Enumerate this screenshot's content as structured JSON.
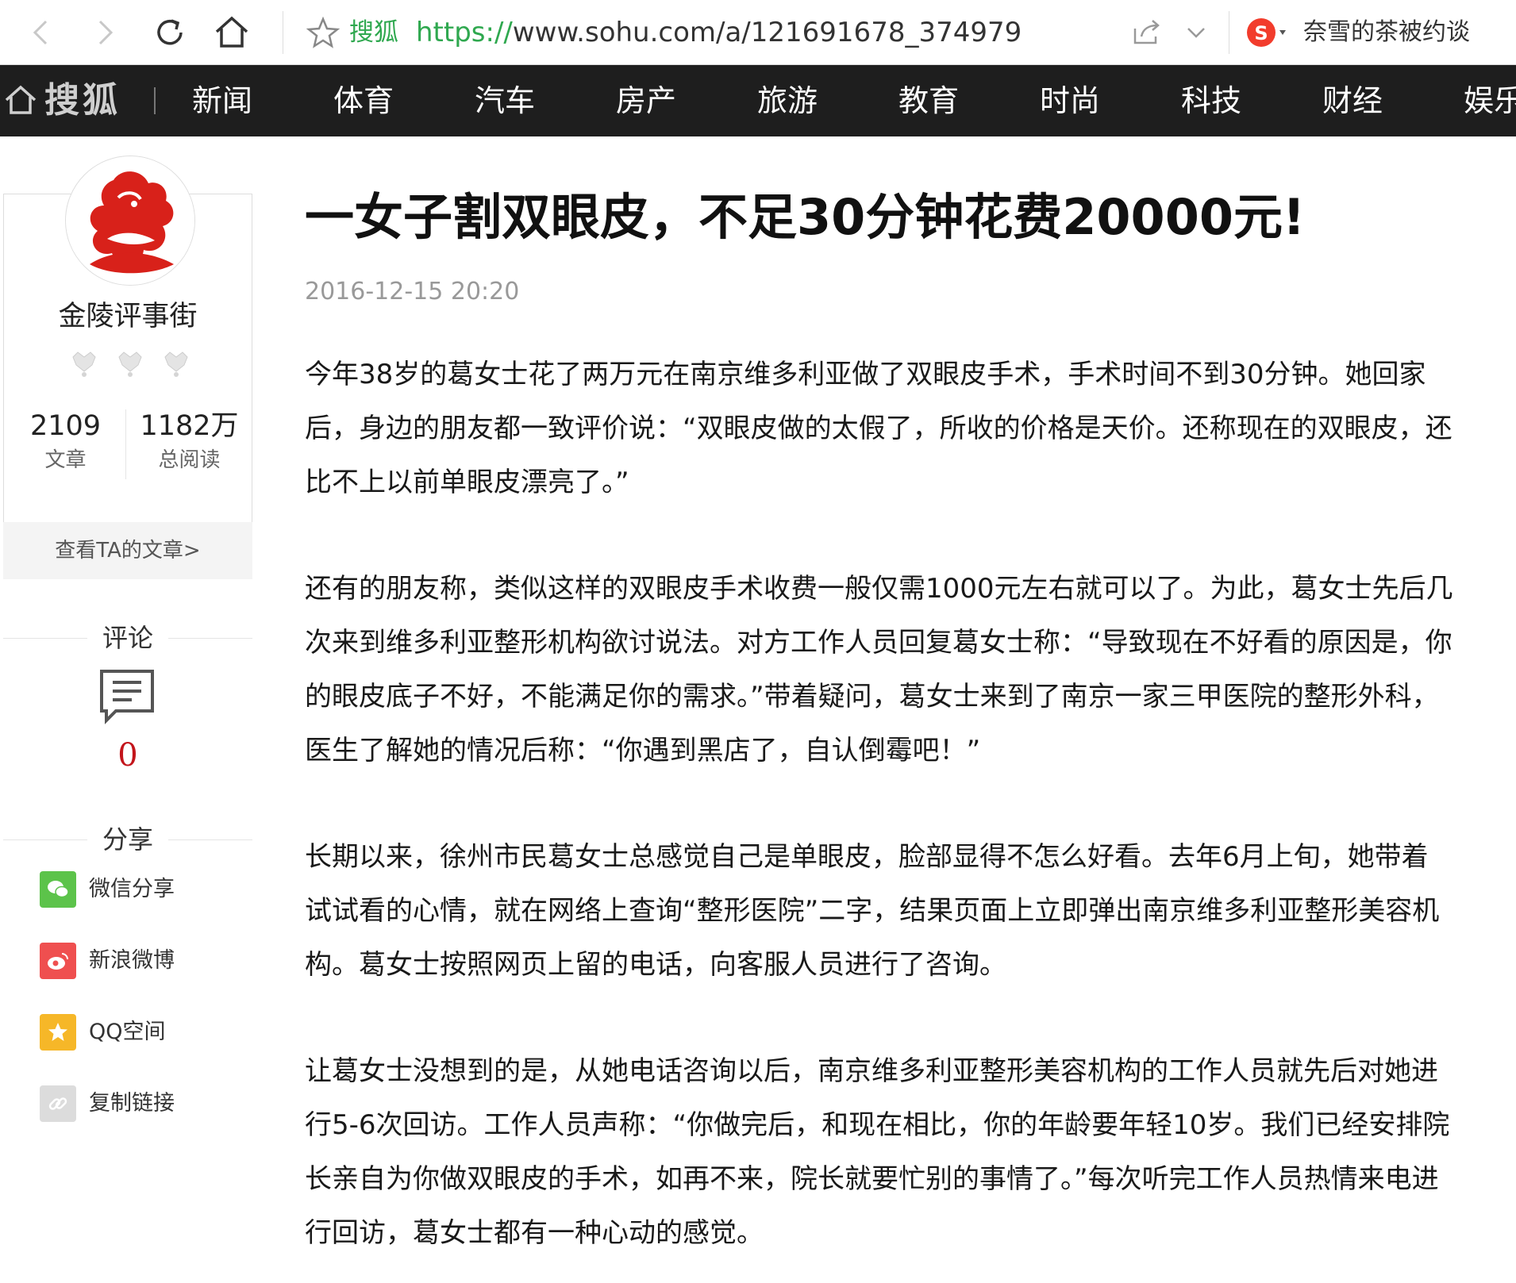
{
  "browser": {
    "site_label": "搜狐",
    "url_protocol": "https://",
    "url_rest": "www.sohu.com/a/121691678_374979",
    "hot_search": "奈雪的茶被约谈"
  },
  "nav": {
    "logo": "搜狐",
    "items": [
      "新闻",
      "体育",
      "汽车",
      "房产",
      "旅游",
      "教育",
      "时尚",
      "科技",
      "财经",
      "娱乐"
    ]
  },
  "author": {
    "name": "金陵评事街",
    "articles_count": "2109",
    "articles_label": "文章",
    "reads_count": "1182万",
    "reads_label": "总阅读",
    "view_link": "查看TA的文章>"
  },
  "comments": {
    "heading": "评论",
    "count": "0"
  },
  "share": {
    "heading": "分享",
    "items": [
      {
        "label": "微信分享",
        "color": "#5cc34a"
      },
      {
        "label": "新浪微博",
        "color": "#ef4f4f"
      },
      {
        "label": "QQ空间",
        "color": "#f6b728"
      },
      {
        "label": "复制链接",
        "color": "#dcdcdc"
      }
    ]
  },
  "article": {
    "title": "一女子割双眼皮，不足30分钟花费20000元!",
    "date": "2016-12-15 20:20",
    "paragraphs": [
      "今年38岁的葛女士花了两万元在南京维多利亚做了双眼皮手术，手术时间不到30分钟。她回家后，身边的朋友都一致评价说：“双眼皮做的太假了，所收的价格是天价。还称现在的双眼皮，还比不上以前单眼皮漂亮了。”",
      "还有的朋友称，类似这样的双眼皮手术收费一般仅需1000元左右就可以了。为此，葛女士先后几次来到维多利亚整形机构欲讨说法。对方工作人员回复葛女士称：“导致现在不好看的原因是，你的眼皮底子不好，不能满足你的需求。”带着疑问，葛女士来到了南京一家三甲医院的整形外科，医生了解她的情况后称：“你遇到黑店了，自认倒霉吧！”",
      "长期以来，徐州市民葛女士总感觉自己是单眼皮，脸部显得不怎么好看。去年6月上旬，她带着试试看的心情，就在网络上查询“整形医院”二字，结果页面上立即弹出南京维多利亚整形美容机构。葛女士按照网页上留的电话，向客服人员进行了咨询。",
      "让葛女士没想到的是，从她电话咨询以后，南京维多利亚整形美容机构的工作人员就先后对她进行5-6次回访。工作人员声称：“你做完后，和现在相比，你的年龄要年轻10岁。我们已经安排院长亲自为你做双眼皮的手术，如再不来，院长就要忙别的事情了。”每次听完工作人员热情来电进行回访，葛女士都有一种心动的感觉。"
    ]
  },
  "colors": {
    "nav_bg": "#1e1e1e",
    "accent_red": "#c3151b",
    "url_green": "#2fa84f"
  }
}
